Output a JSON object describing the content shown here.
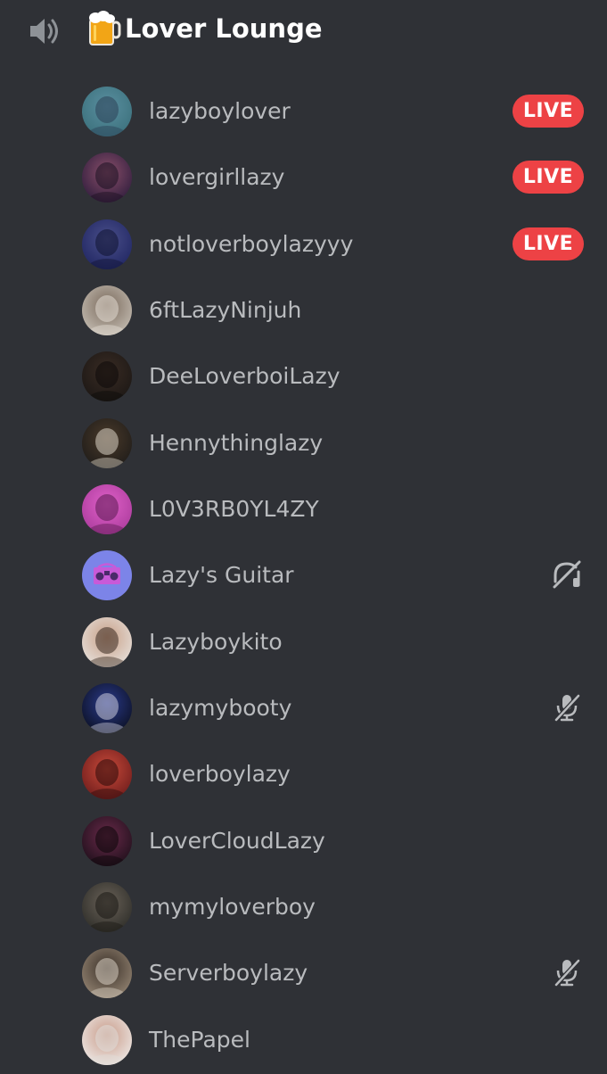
{
  "channel": {
    "icon": "speaker-icon",
    "emoji": "beer-mug-emoji",
    "name": "Lover Lounge"
  },
  "colors": {
    "background": "#2f3136",
    "live_badge": "#ed4245",
    "username_text": "#b9bbbe",
    "header_text": "#ffffff"
  },
  "members": [
    {
      "username": "lazyboylover",
      "badge": "LIVE",
      "status_icon": null,
      "avatar_colors": [
        "#3a6f7a",
        "#5a8fa0",
        "#2b3f55"
      ]
    },
    {
      "username": "lovergirllazy",
      "badge": "LIVE",
      "status_icon": null,
      "avatar_colors": [
        "#2a1a3a",
        "#8a4f6a",
        "#1a1020"
      ]
    },
    {
      "username": "notloverboylazyyy",
      "badge": "LIVE",
      "status_icon": null,
      "avatar_colors": [
        "#1e2460",
        "#4a4f8a",
        "#0f1230"
      ]
    },
    {
      "username": "6ftLazyNinjuh",
      "badge": null,
      "status_icon": null,
      "avatar_colors": [
        "#c9c2b8",
        "#7a6a5c",
        "#e4ddd4"
      ]
    },
    {
      "username": "DeeLoverboiLazy",
      "badge": null,
      "status_icon": null,
      "avatar_colors": [
        "#1a1614",
        "#3a2c24",
        "#0c0a09"
      ]
    },
    {
      "username": "Hennythinglazy",
      "badge": null,
      "status_icon": null,
      "avatar_colors": [
        "#1c1a18",
        "#4a3a2a",
        "#d9d2c5"
      ]
    },
    {
      "username": "L0V3RB0YL4ZY",
      "badge": null,
      "status_icon": null,
      "avatar_colors": [
        "#a83a9a",
        "#e060c8",
        "#5a1a50"
      ]
    },
    {
      "username": "Lazy's Guitar",
      "badge": null,
      "status_icon": "deafened-headphones-icon",
      "avatar_colors": [
        "#7c84e8",
        "#9aa0f0",
        "#c85ad8"
      ]
    },
    {
      "username": "Lazyboykito",
      "badge": null,
      "status_icon": null,
      "avatar_colors": [
        "#e8e4e0",
        "#c8a088",
        "#3a2a20"
      ]
    },
    {
      "username": "lazymybooty",
      "badge": null,
      "status_icon": "muted-microphone-icon",
      "avatar_colors": [
        "#0a0e1e",
        "#2a3a8a",
        "#c8c8d8"
      ]
    },
    {
      "username": "loverboylazy",
      "badge": null,
      "status_icon": null,
      "avatar_colors": [
        "#6a1a1a",
        "#c84a3a",
        "#2a0a0a"
      ]
    },
    {
      "username": "LoverCloudLazy",
      "badge": null,
      "status_icon": null,
      "avatar_colors": [
        "#1a0e18",
        "#6a2a4a",
        "#0a0608"
      ]
    },
    {
      "username": "mymyloverboy",
      "badge": null,
      "status_icon": null,
      "avatar_colors": [
        "#2a2a26",
        "#6a6258",
        "#1a1814"
      ]
    },
    {
      "username": "Serverboylazy",
      "badge": null,
      "status_icon": "muted-microphone-icon",
      "avatar_colors": [
        "#9a8a78",
        "#3a3028",
        "#d8cfc2"
      ]
    },
    {
      "username": "ThePapel",
      "badge": null,
      "status_icon": null,
      "avatar_colors": [
        "#f0eeec",
        "#c89a88",
        "#e0dcd8"
      ]
    }
  ]
}
